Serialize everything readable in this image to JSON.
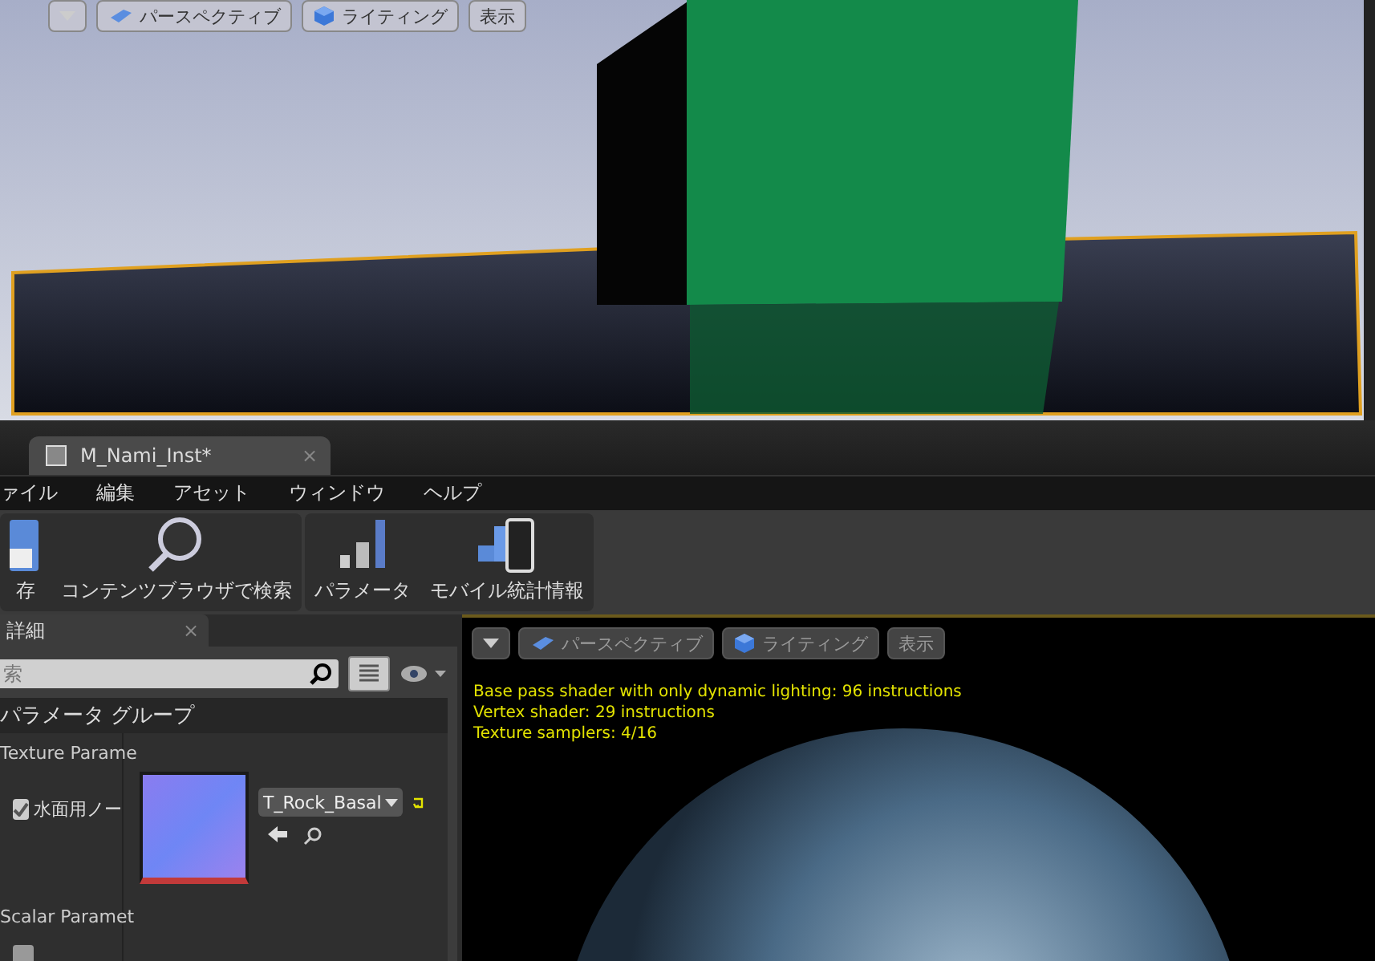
{
  "main_viewport": {
    "toolbar": [
      {
        "kind": "dropdown"
      },
      {
        "kind": "view",
        "label": "パースペクティブ"
      },
      {
        "kind": "light",
        "label": "ライティング"
      },
      {
        "kind": "plain",
        "label": "表示"
      }
    ]
  },
  "editor_tab": {
    "title": "M_Nami_Inst*",
    "close": "×"
  },
  "menu": [
    "ァイル",
    "編集",
    "アセット",
    "ウィンドウ",
    "ヘルプ"
  ],
  "toolbar": [
    {
      "kind": "save",
      "label": "存"
    },
    {
      "kind": "browse",
      "label": "コンテンツブラウザで検索"
    },
    {
      "kind": "params",
      "label": "パラメータ"
    },
    {
      "kind": "mobile",
      "label": "モバイル統計情報"
    }
  ],
  "details": {
    "tab": "詳細",
    "close": "×",
    "search": {
      "placeholder": "索"
    },
    "group": "パラメータ グループ",
    "sections": [
      {
        "title": "Texture Parame",
        "param": {
          "kind": "texture",
          "name": "水面用ノー",
          "checked": true,
          "value": "T_Rock_Basal"
        }
      },
      {
        "title": "Scalar Paramet",
        "param": {
          "kind": "scalar",
          "checked": false
        }
      }
    ]
  },
  "preview": {
    "toolbar": [
      {
        "kind": "dropdown"
      },
      {
        "kind": "view",
        "label": "パースペクティブ"
      },
      {
        "kind": "light",
        "label": "ライティング"
      },
      {
        "kind": "plain",
        "label": "表示"
      }
    ],
    "stats": [
      "Base pass shader with only dynamic lighting: 96 instructions",
      "Vertex shader: 29 instructions",
      "Texture samplers: 4/16"
    ]
  }
}
